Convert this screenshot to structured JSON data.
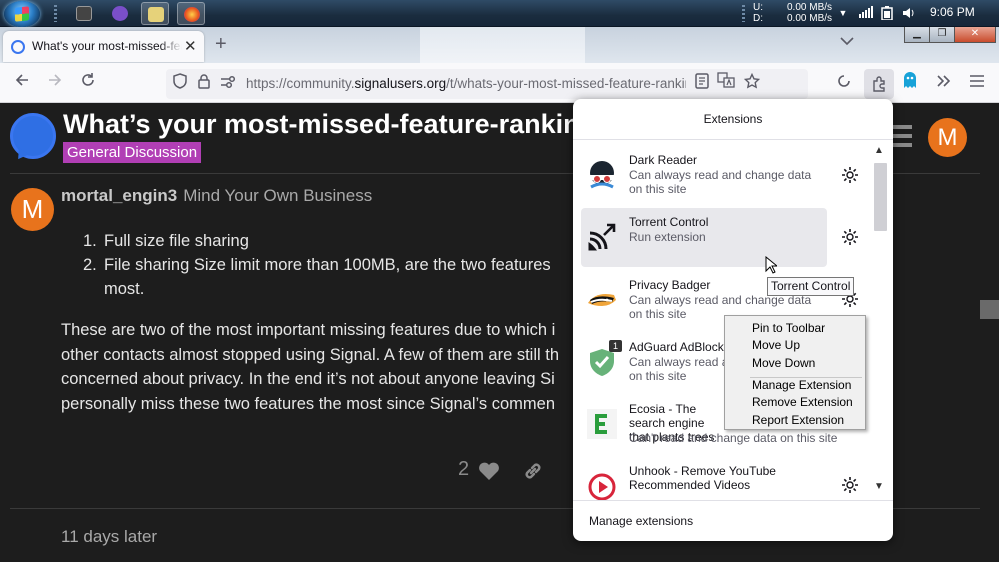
{
  "taskbar": {
    "net_up_label": "U:",
    "net_down_label": "D:",
    "net_up": "0.00 MB/s",
    "net_down": "0.00 MB/s",
    "clock": "9:06 PM"
  },
  "browser": {
    "tab_title": "What's your most-missed-feature-ranking",
    "url_prefix": "https://community.",
    "url_host": "signalusers.org",
    "url_path": "/t/whats-your-most-missed-feature-ranking/"
  },
  "page": {
    "title": "What’s your most-missed-feature-ranking",
    "category": "General Discussion",
    "avatar_letter": "M",
    "username": "mortal_engin3",
    "user_title": "Mind Your Own Business",
    "list": [
      {
        "num": "1.",
        "lines": [
          "Full size file sharing"
        ]
      },
      {
        "num": "2.",
        "lines": [
          "File sharing Size limit more than 100MB, are the two features",
          "most."
        ]
      }
    ],
    "paragraph": [
      "These are two of the most important missing features due to which i",
      "other contacts almost stopped using Signal. A few of them are still th",
      "concerned about privacy. In the end it’s not about anyone leaving Si",
      "personally miss these two features the most since Signal’s commen"
    ],
    "like_count": "2",
    "time_gap": "11 days later"
  },
  "extensions_panel": {
    "header": "Extensions",
    "items": [
      {
        "name": "Dark Reader",
        "desc": "Can always read and change data on this site"
      },
      {
        "name": "Torrent Control",
        "desc": "Run extension"
      },
      {
        "name": "Privacy Badger",
        "desc": "Can always read and change data on this site"
      },
      {
        "name": "AdGuard AdBlocker",
        "desc": "Can always read and change data on this site",
        "badge": "1"
      },
      {
        "name": "Ecosia - The search engine that plants trees",
        "desc": "Can't read and change data on this site"
      },
      {
        "name": "Unhook - Remove YouTube Recommended Videos",
        "desc": ""
      }
    ],
    "footer": "Manage extensions"
  },
  "tooltip": "Torrent Control",
  "context_menu": {
    "items": [
      "Pin to Toolbar",
      "Move Up",
      "Move Down"
    ],
    "items2": [
      "Manage Extension",
      "Remove Extension",
      "Report Extension"
    ]
  },
  "colors": {
    "accent": "#3a76f0",
    "category_bg": "#b13fb5",
    "avatar_bg": "#e8731c",
    "page_bg": "#1d1d1d"
  }
}
